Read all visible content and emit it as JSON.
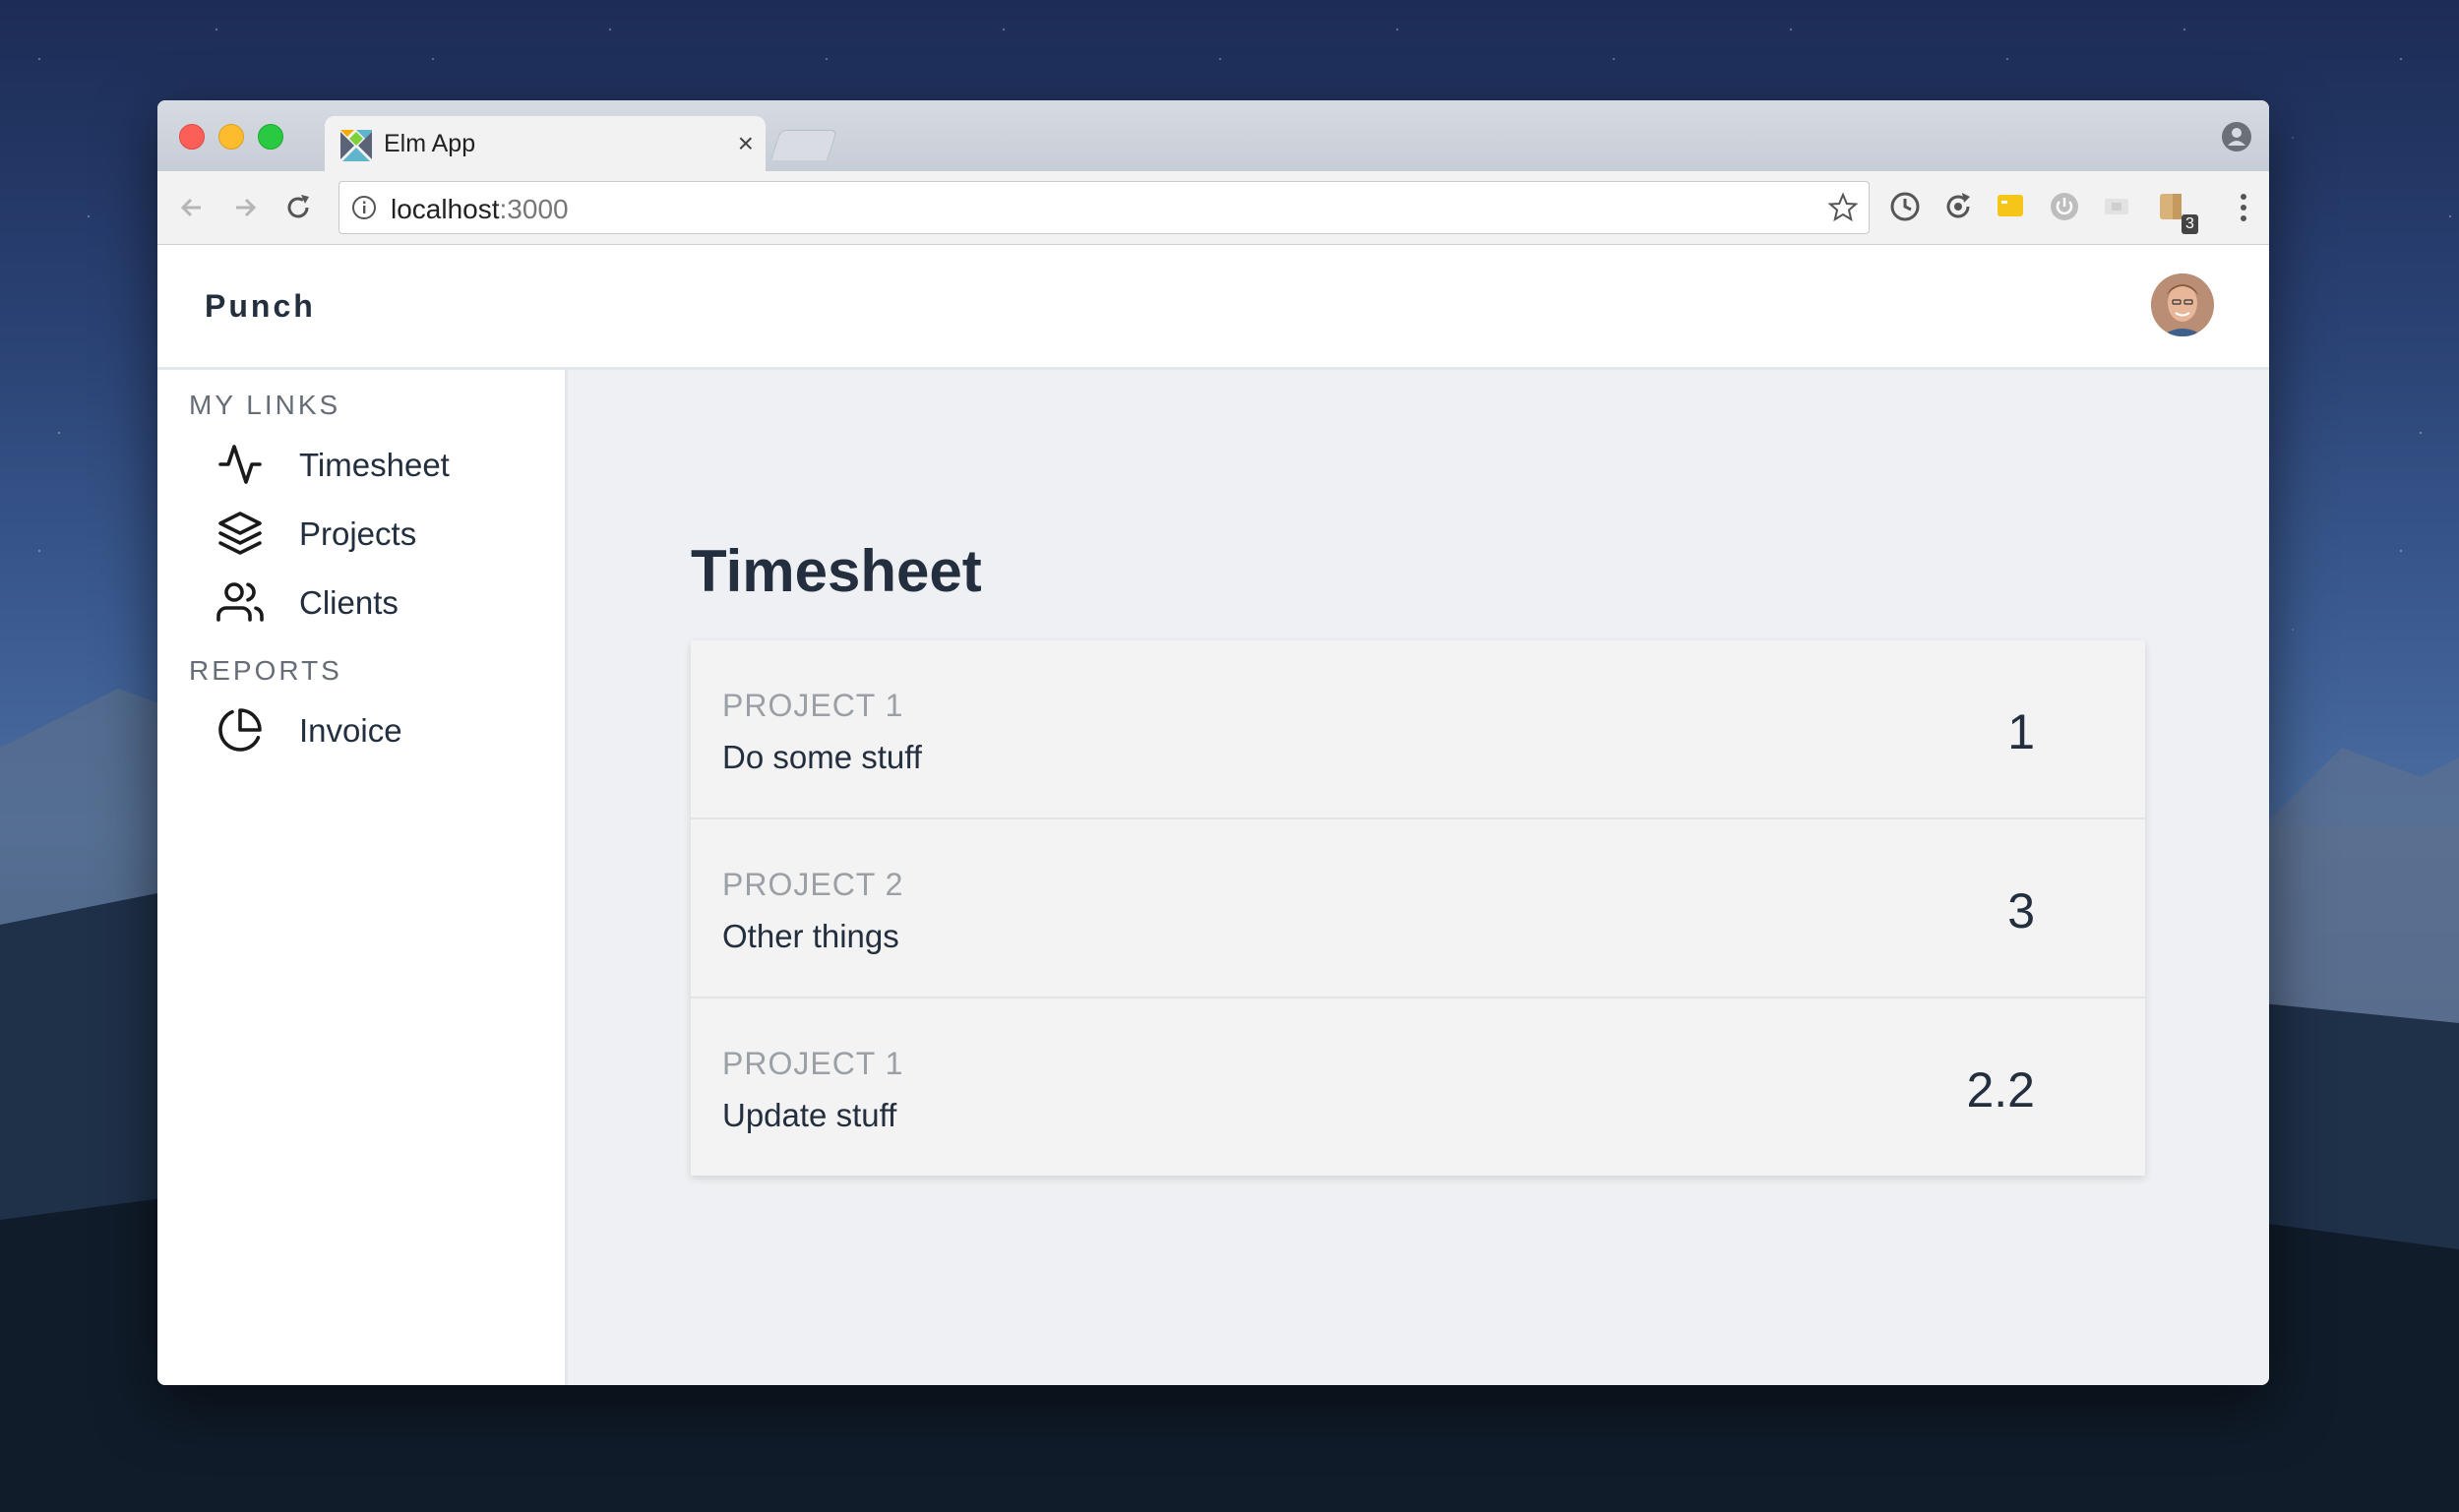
{
  "browser": {
    "tab_title": "Elm App",
    "tab_close": "×",
    "url_host": "localhost",
    "url_port": ":3000",
    "extension_badge": "3"
  },
  "app": {
    "brand": "Punch"
  },
  "sidebar": {
    "sections": [
      {
        "title": "MY LINKS",
        "items": [
          {
            "label": "Timesheet",
            "icon": "activity-icon"
          },
          {
            "label": "Projects",
            "icon": "layers-icon"
          },
          {
            "label": "Clients",
            "icon": "users-icon"
          }
        ]
      },
      {
        "title": "REPORTS",
        "items": [
          {
            "label": "Invoice",
            "icon": "pie-chart-icon"
          }
        ]
      }
    ]
  },
  "main": {
    "title": "Timesheet",
    "entries": [
      {
        "project": "PROJECT 1",
        "description": "Do some stuff",
        "hours": "1"
      },
      {
        "project": "PROJECT 2",
        "description": "Other things",
        "hours": "3"
      },
      {
        "project": "PROJECT 1",
        "description": "Update stuff",
        "hours": "2.2"
      }
    ]
  },
  "colors": {
    "text_dark": "#232f3e",
    "muted": "#9aa0a6",
    "page_bg": "#eef0f3"
  }
}
